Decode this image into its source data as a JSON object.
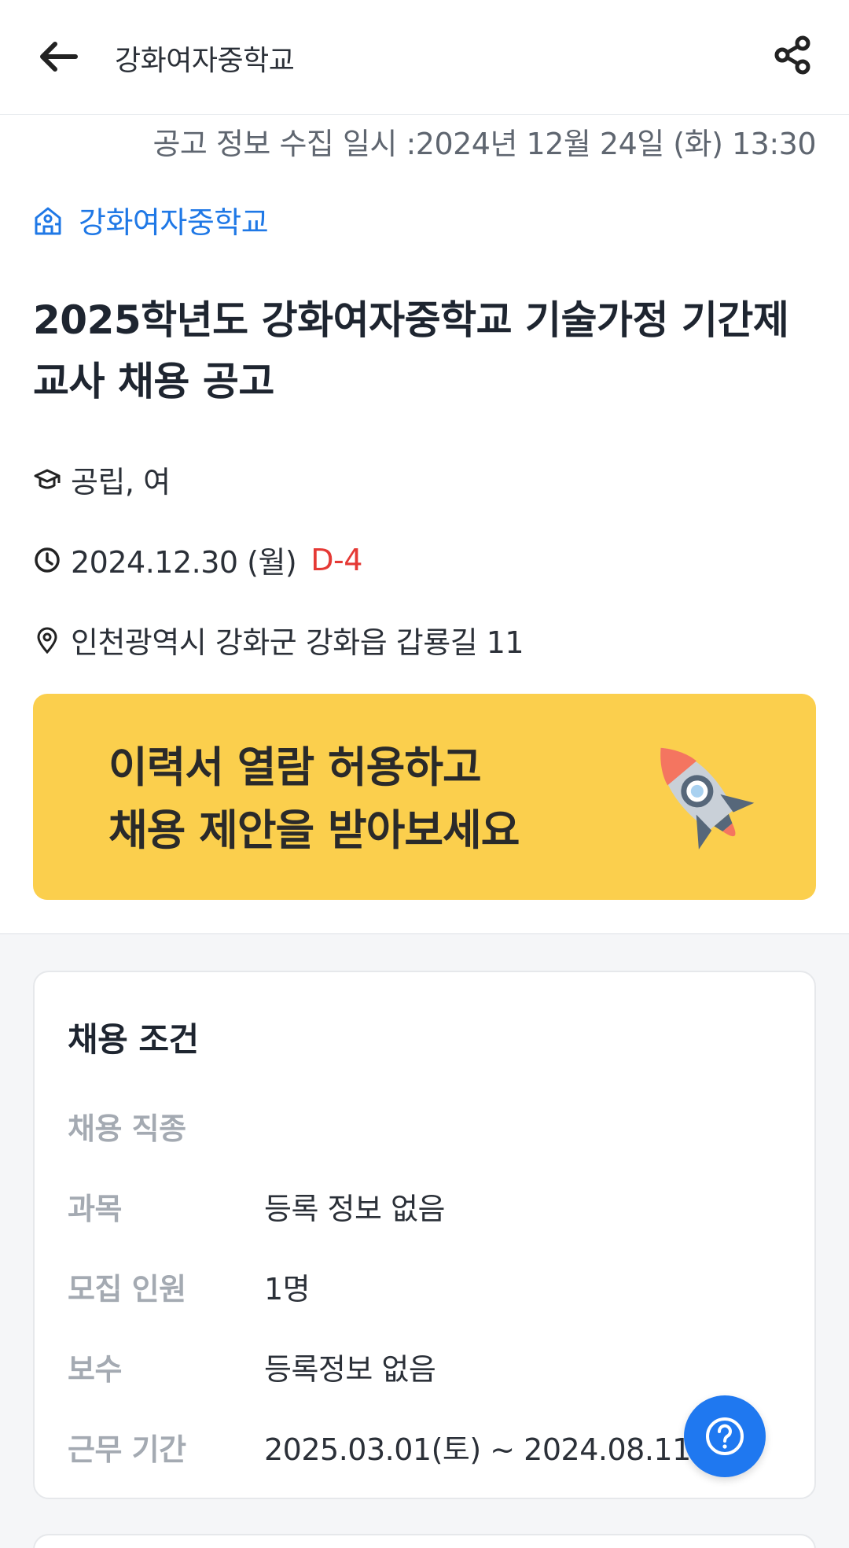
{
  "header": {
    "title": "강화여자중학교",
    "back_icon": "arrow-left-icon",
    "share_icon": "share-icon"
  },
  "posting": {
    "collected_at": "공고 정보 수집 일시 :2024년 12월 24일 (화) 13:30",
    "school_name": "강화여자중학교",
    "title": "2025학년도 강화여자중학교 기술가정 기간제 교사 채용 공고",
    "school_type": "공립, 여",
    "deadline": "2024.12.30 (월)",
    "dday": "D-4",
    "address": "인천광역시 강화군 강화읍 갑룡길 11"
  },
  "banner": {
    "line1": "이력서 열람 허용하고",
    "line2": "채용 제안을 받아보세요"
  },
  "conditions": {
    "title": "채용 조건",
    "rows": [
      {
        "label": "채용 직종",
        "value": ""
      },
      {
        "label": "과목",
        "value": "등록 정보 없음"
      },
      {
        "label": "모집 인원",
        "value": "1명"
      },
      {
        "label": "보수",
        "value": "등록정보 없음"
      },
      {
        "label": "근무 기간",
        "value": "2025.03.01(토) ~ 2024.08.11(월)"
      }
    ]
  },
  "colors": {
    "accent": "#1f78e6",
    "dday": "#e53935",
    "banner": "#fbcf4d"
  }
}
